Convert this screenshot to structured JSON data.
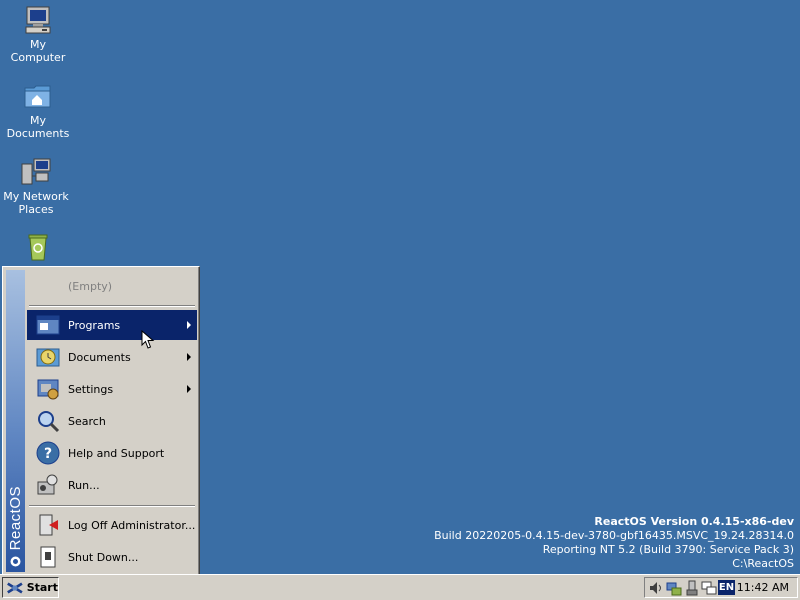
{
  "desktop": {
    "icons": [
      {
        "label_line1": "My",
        "label_line2": "Computer",
        "icon": "computer-icon"
      },
      {
        "label_line1": "My",
        "label_line2": "Documents",
        "icon": "documents-folder-icon"
      },
      {
        "label_line1": "My Network",
        "label_line2": "Places",
        "icon": "network-places-icon"
      },
      {
        "label_line1": "",
        "label_line2": "",
        "icon": "recycle-bin-icon"
      }
    ]
  },
  "version_info": {
    "title": "ReactOS Version 0.4.15-x86-dev",
    "build": "Build 20220205-0.4.15-dev-3780-gbf16435.MSVC_19.24.28314.0",
    "reporting": "Reporting NT 5.2 (Build 3790: Service Pack 3)",
    "path": "C:\\ReactOS"
  },
  "start_menu": {
    "banner_text": "ReactOS",
    "empty_label": "(Empty)",
    "items": [
      {
        "label": "Programs",
        "icon": "programs-icon",
        "submenu": true,
        "selected": true
      },
      {
        "label": "Documents",
        "icon": "documents-icon",
        "submenu": true
      },
      {
        "label": "Settings",
        "icon": "settings-icon",
        "submenu": true
      },
      {
        "label": "Search",
        "icon": "search-icon",
        "submenu": false
      },
      {
        "label": "Help and Support",
        "icon": "help-icon",
        "submenu": false
      },
      {
        "label": "Run...",
        "icon": "run-icon",
        "submenu": false
      }
    ],
    "bottom_items": [
      {
        "label": "Log Off Administrator...",
        "icon": "log-off-icon"
      },
      {
        "label": "Shut Down...",
        "icon": "shut-down-icon"
      }
    ]
  },
  "taskbar": {
    "start_label": "Start",
    "language": "EN",
    "clock": "11:42 AM",
    "tray_icons": [
      "volume-icon",
      "network-icon",
      "safely-remove-icon",
      "display-icon"
    ]
  },
  "colors": {
    "desktop": "#3a6ea5",
    "selection": "#0a246a",
    "face": "#d4d0c8"
  }
}
